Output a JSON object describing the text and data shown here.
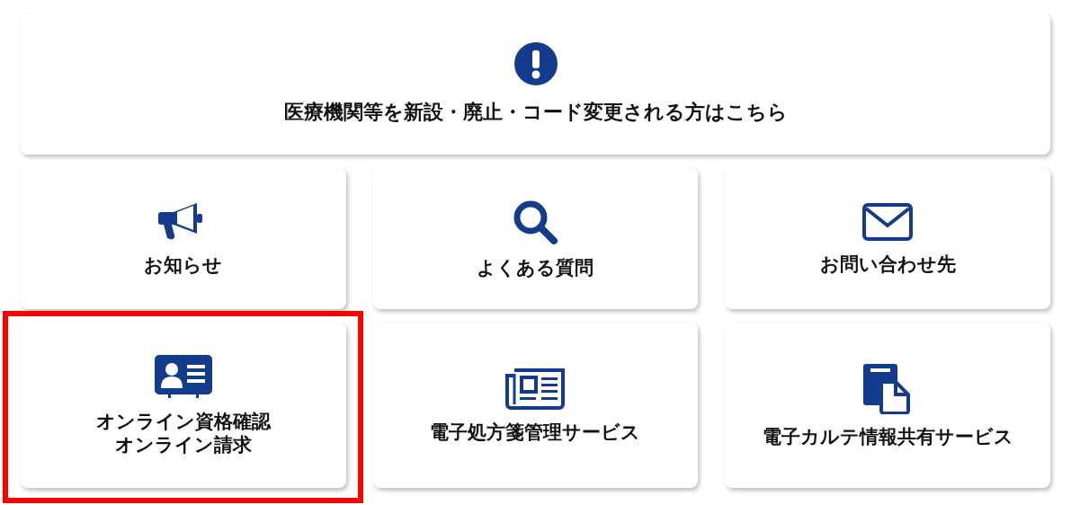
{
  "notice": {
    "label": "医療機関等を新設・廃止・コード変更される方はこちら"
  },
  "cards": [
    {
      "kind": "megaphone",
      "lines": [
        "お知らせ"
      ],
      "highlighted": false
    },
    {
      "kind": "search",
      "lines": [
        "よくある質問"
      ],
      "highlighted": false
    },
    {
      "kind": "mail",
      "lines": [
        "お問い合わせ先"
      ],
      "highlighted": false
    },
    {
      "kind": "idcard",
      "lines": [
        "オンライン資格確認",
        "オンライン請求"
      ],
      "highlighted": true
    },
    {
      "kind": "newspaper",
      "lines": [
        "電子処方箋管理サービス"
      ],
      "highlighted": false
    },
    {
      "kind": "documents",
      "lines": [
        "電子カルテ情報共有サービス"
      ],
      "highlighted": false
    }
  ]
}
